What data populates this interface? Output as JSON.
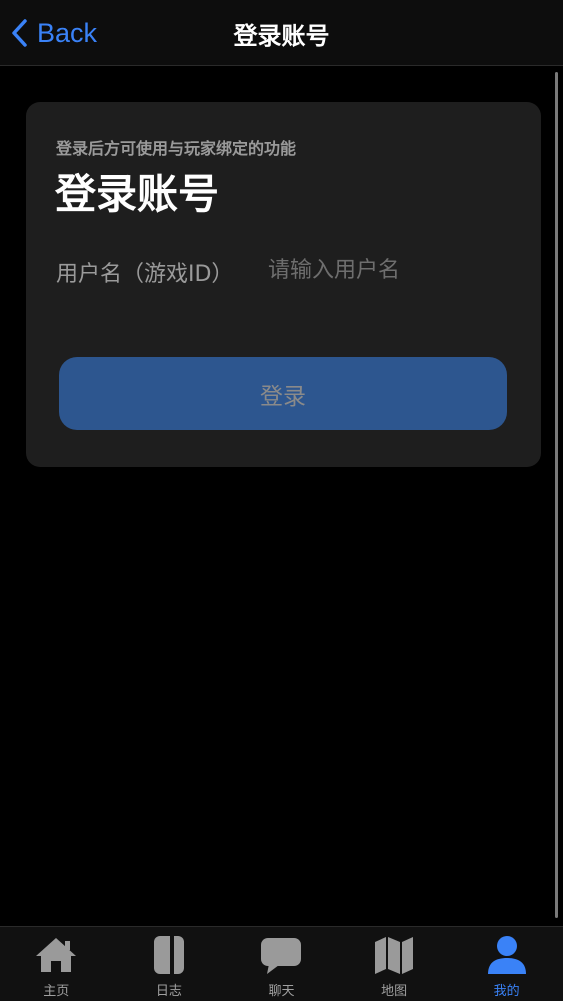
{
  "nav": {
    "back_label": "Back",
    "title": "登录账号"
  },
  "card": {
    "subtitle": "登录后方可使用与玩家绑定的功能",
    "title": "登录账号",
    "username_label": "用户名（游戏ID）",
    "username_placeholder": "请输入用户名",
    "username_value": "",
    "login_button_label": "登录"
  },
  "tabs": [
    {
      "label": "主页",
      "icon": "home-icon",
      "active": false
    },
    {
      "label": "日志",
      "icon": "journal-icon",
      "active": false
    },
    {
      "label": "聊天",
      "icon": "chat-icon",
      "active": false
    },
    {
      "label": "地图",
      "icon": "map-icon",
      "active": false
    },
    {
      "label": "我的",
      "icon": "person-icon",
      "active": true
    }
  ],
  "colors": {
    "accent": "#3a82f7",
    "button": "#2d568f",
    "card": "#1e1e1e",
    "background": "#000000"
  }
}
